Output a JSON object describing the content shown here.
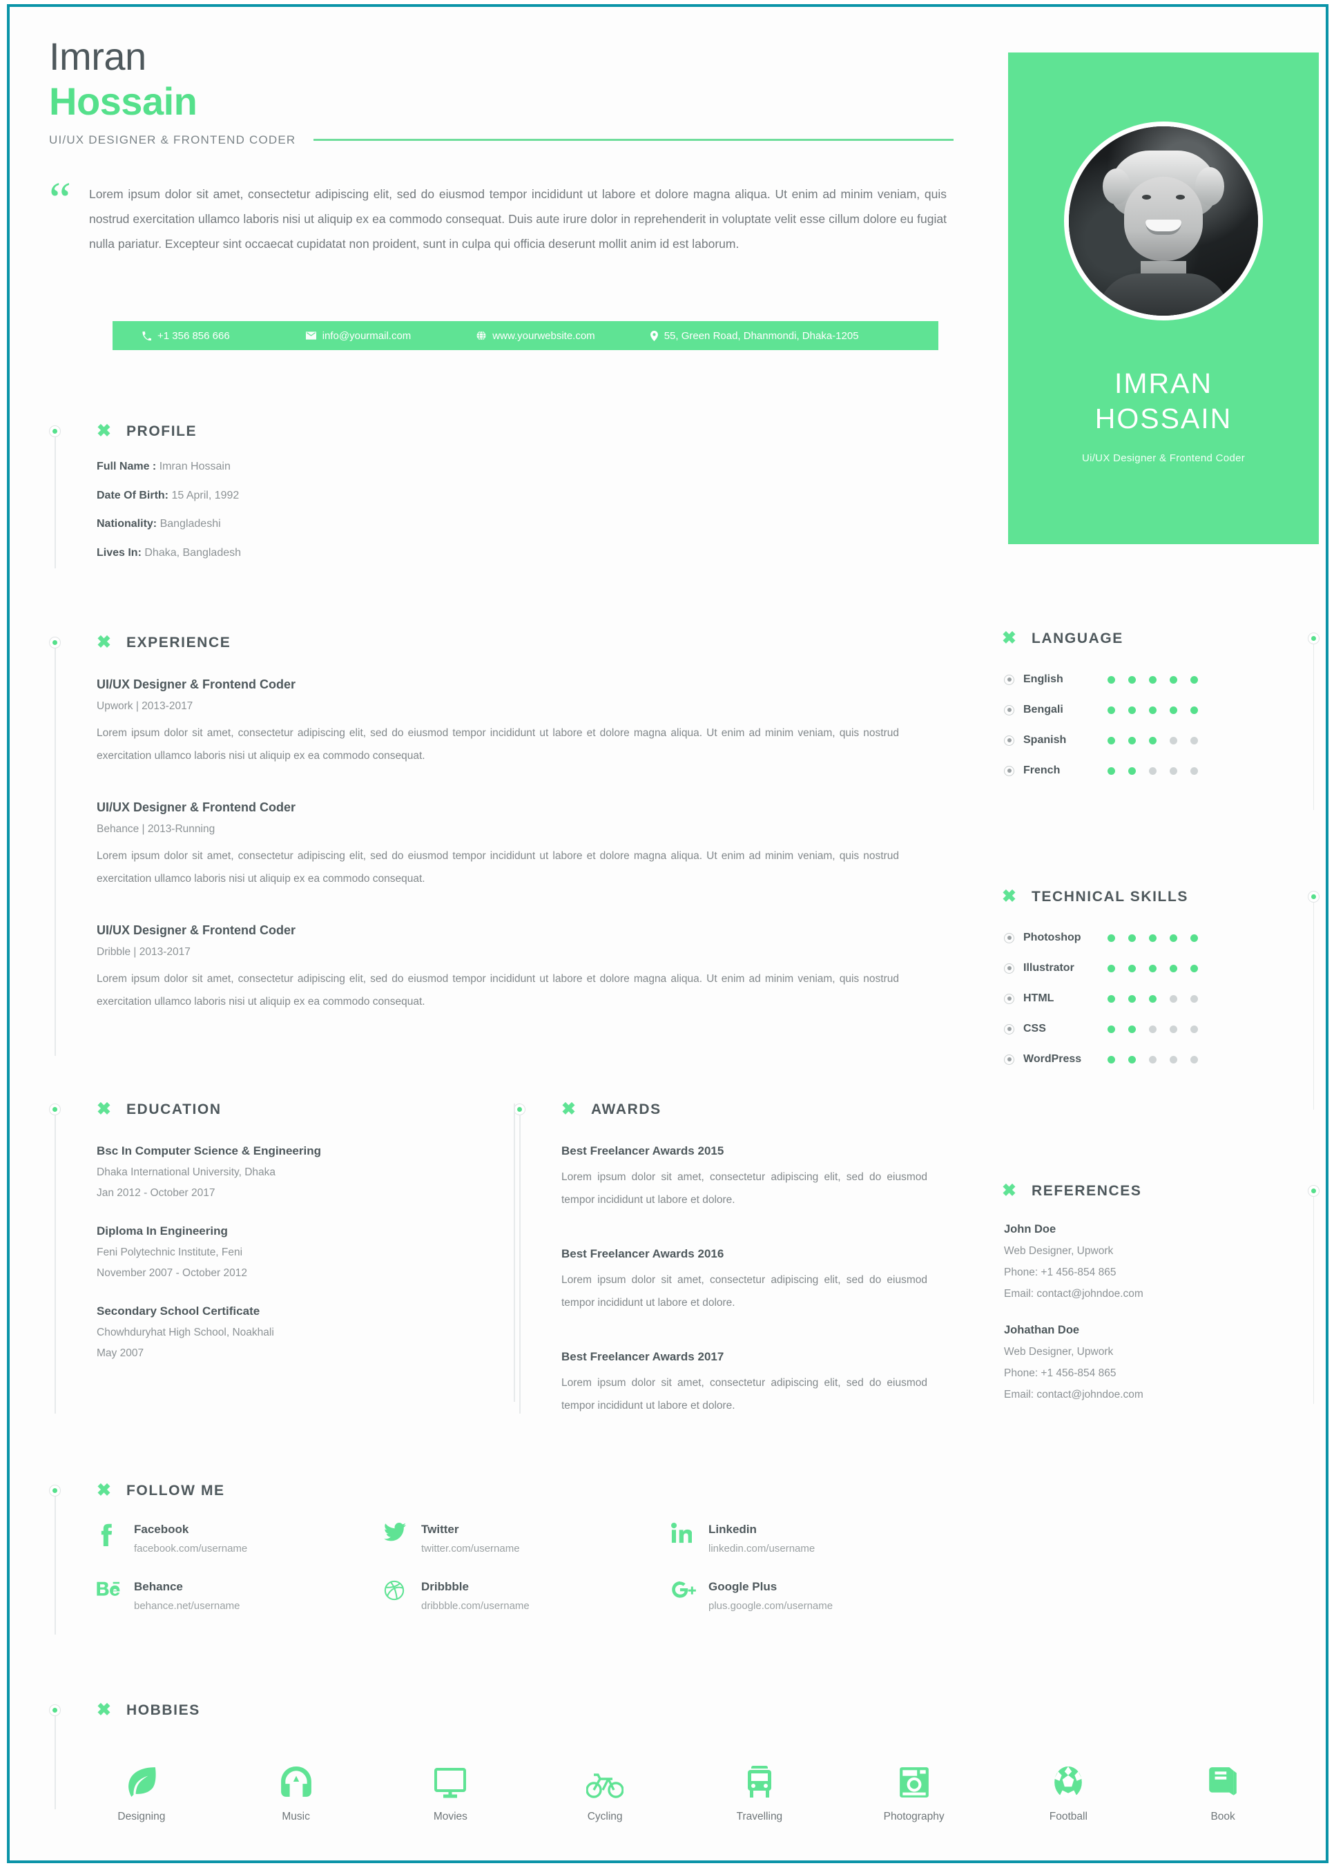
{
  "theme": {
    "green": "#5fe394",
    "green_dark": "#55e08b",
    "heading": "#4e585c",
    "body": "#82888b",
    "border": "#0b94a8"
  },
  "header": {
    "first_name": "Imran",
    "last_name": "Hossain",
    "role": "UI/UX DESIGNER & FRONTEND CODER"
  },
  "intro": {
    "quote_mark": "“",
    "text": "Lorem ipsum dolor sit amet, consectetur adipiscing elit, sed do eiusmod tempor incididunt ut labore et dolore magna aliqua. Ut enim ad minim veniam, quis nostrud exercitation ullamco laboris nisi ut aliquip ex ea commodo consequat. Duis aute irure dolor in reprehenderit in voluptate velit esse cillum dolore eu fugiat nulla pariatur. Excepteur sint occaecat cupidatat non proident, sunt in culpa qui officia deserunt mollit anim id est laborum."
  },
  "contact": {
    "phone": "+1 356 856 666",
    "email": "info@yourmail.com",
    "website": "www.yourwebsite.com",
    "address": "55, Green Road, Dhanmondi, Dhaka-1205"
  },
  "profile_card": {
    "name_line1": "IMRAN",
    "name_line2": "HOSSAIN",
    "role": "Ui/UX Designer & Frontend Coder"
  },
  "profile": {
    "title": "PROFILE",
    "rows": [
      {
        "label": "Full Name :",
        "value": "Imran Hossain"
      },
      {
        "label": "Date Of Birth:",
        "value": "15 April, 1992"
      },
      {
        "label": "Nationality:",
        "value": "Bangladeshi"
      },
      {
        "label": "Lives In:",
        "value": "Dhaka, Bangladesh"
      }
    ]
  },
  "experience": {
    "title": "EXPERIENCE",
    "items": [
      {
        "role": "UI/UX Designer & Frontend Coder",
        "meta": "Upwork | 2013-2017",
        "desc": "Lorem ipsum dolor sit amet, consectetur adipiscing elit, sed do eiusmod tempor incididunt ut labore et dolore magna aliqua. Ut enim ad minim veniam, quis nostrud exercitation ullamco laboris nisi ut aliquip ex ea commodo consequat."
      },
      {
        "role": "UI/UX Designer & Frontend Coder",
        "meta": "Behance | 2013-Running",
        "desc": "Lorem ipsum dolor sit amet, consectetur adipiscing elit, sed do eiusmod tempor incididunt ut labore et dolore magna aliqua. Ut enim ad minim veniam, quis nostrud exercitation ullamco laboris nisi ut aliquip ex ea commodo consequat."
      },
      {
        "role": "UI/UX Designer & Frontend Coder",
        "meta": "Dribble | 2013-2017",
        "desc": "Lorem ipsum dolor sit amet, consectetur adipiscing elit, sed do eiusmod tempor incididunt ut labore et dolore magna aliqua. Ut enim ad minim veniam, quis nostrud exercitation ullamco laboris nisi ut aliquip ex ea commodo consequat."
      }
    ]
  },
  "education": {
    "title": "EDUCATION",
    "items": [
      {
        "degree": "Bsc In Computer Science & Engineering",
        "school": "Dhaka International University, Dhaka",
        "dates": "Jan 2012 - October 2017"
      },
      {
        "degree": "Diploma In Engineering",
        "school": "Feni Polytechnic Institute, Feni",
        "dates": "November 2007 - October 2012"
      },
      {
        "degree": "Secondary School Certificate",
        "school": "Chowhduryhat High School, Noakhali",
        "dates": "May 2007"
      }
    ]
  },
  "awards": {
    "title": "AWARDS",
    "items": [
      {
        "name": "Best Freelancer Awards 2015",
        "desc": "Lorem ipsum dolor sit amet, consectetur adipiscing elit, sed do eiusmod tempor incididunt ut labore et dolore."
      },
      {
        "name": "Best Freelancer Awards 2016",
        "desc": "Lorem ipsum dolor sit amet, consectetur adipiscing elit, sed do eiusmod tempor incididunt ut labore et dolore."
      },
      {
        "name": "Best Freelancer Awards 2017",
        "desc": "Lorem ipsum dolor sit amet, consectetur adipiscing elit, sed do eiusmod tempor incididunt ut labore et dolore."
      }
    ]
  },
  "language": {
    "title": "LANGUAGE",
    "max": 5,
    "items": [
      {
        "label": "English",
        "level": 5
      },
      {
        "label": "Bengali",
        "level": 5
      },
      {
        "label": "Spanish",
        "level": 3
      },
      {
        "label": "French",
        "level": 2
      }
    ]
  },
  "technical_skills": {
    "title": "TECHNICAL SKILLS",
    "max": 5,
    "items": [
      {
        "label": "Photoshop",
        "level": 5
      },
      {
        "label": "Illustrator",
        "level": 5
      },
      {
        "label": "HTML",
        "level": 3
      },
      {
        "label": "CSS",
        "level": 2
      },
      {
        "label": "WordPress",
        "level": 2
      }
    ]
  },
  "references": {
    "title": "REFERENCES",
    "items": [
      {
        "name": "John Doe",
        "role": "Web Designer, Upwork",
        "phone": "Phone: +1 456-854 865",
        "email": "Email: contact@johndoe.com"
      },
      {
        "name": "Johathan Doe",
        "role": "Web Designer, Upwork",
        "phone": "Phone: +1 456-854 865",
        "email": "Email: contact@johndoe.com"
      }
    ]
  },
  "follow": {
    "title": "FOLLOW ME",
    "items": [
      {
        "icon": "facebook-icon",
        "name": "Facebook",
        "url": "facebook.com/username"
      },
      {
        "icon": "twitter-icon",
        "name": "Twitter",
        "url": "twitter.com/username"
      },
      {
        "icon": "linkedin-icon",
        "name": "Linkedin",
        "url": "linkedin.com/username"
      },
      {
        "icon": "behance-icon",
        "name": "Behance",
        "url": "behance.net/username"
      },
      {
        "icon": "dribbble-icon",
        "name": "Dribbble",
        "url": "dribbble.com/username"
      },
      {
        "icon": "google-plus-icon",
        "name": "Google Plus",
        "url": "plus.google.com/username"
      }
    ]
  },
  "hobbies": {
    "title": "HOBBIES",
    "items": [
      {
        "icon": "leaf-icon",
        "label": "Designing"
      },
      {
        "icon": "headphones-icon",
        "label": "Music"
      },
      {
        "icon": "monitor-icon",
        "label": "Movies"
      },
      {
        "icon": "bicycle-icon",
        "label": "Cycling"
      },
      {
        "icon": "bus-icon",
        "label": "Travelling"
      },
      {
        "icon": "camera-icon",
        "label": "Photography"
      },
      {
        "icon": "football-icon",
        "label": "Football"
      },
      {
        "icon": "book-icon",
        "label": "Book"
      }
    ]
  }
}
